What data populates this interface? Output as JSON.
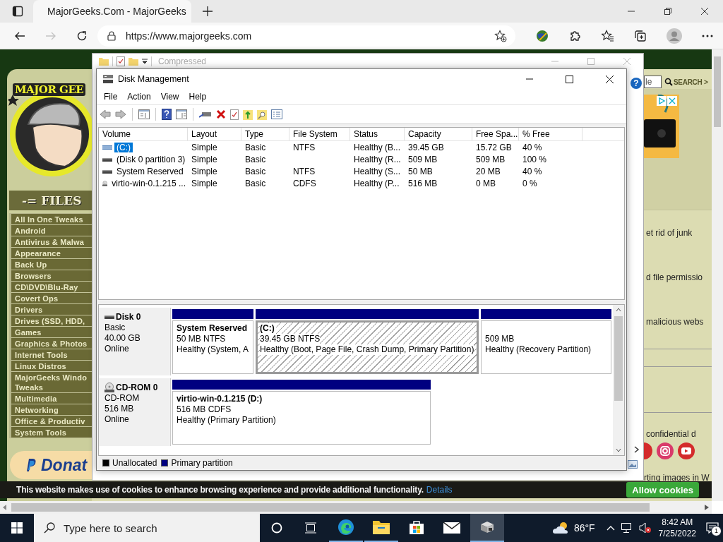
{
  "browser": {
    "tabs": [
      {
        "title": "MajorGeeks.Com - MajorGeeks",
        "selected": true
      }
    ],
    "url": "https://www.majorgeeks.com",
    "forward_disabled": true
  },
  "website": {
    "logo_text": "MAJOR GEE",
    "files_heading": "-= FILES",
    "categories": [
      {
        "label": "All In One Tweaks"
      },
      {
        "label": "Android"
      },
      {
        "label": "Antivirus & Malwa"
      },
      {
        "label": "Appearance"
      },
      {
        "label": "Back Up"
      },
      {
        "label": "Browsers"
      },
      {
        "label": "CD\\DVD\\Blu-Ray"
      },
      {
        "label": "Covert Ops"
      },
      {
        "label": "Drivers"
      },
      {
        "label": "Drives (SSD, HDD,"
      },
      {
        "label": "Games"
      },
      {
        "label": "Graphics & Photos"
      },
      {
        "label": "Internet Tools"
      },
      {
        "label": "Linux Distros"
      },
      {
        "label": "MajorGeeks Windo\nTweaks"
      },
      {
        "label": "Multimedia"
      },
      {
        "label": "Networking"
      },
      {
        "label": "Office & Productiv"
      },
      {
        "label": "System Tools"
      }
    ],
    "donate": "Donat",
    "search_value": "le",
    "search_label": "SEARCH >",
    "snippets": [
      "et rid of junk",
      "d file permissio",
      "malicious webs",
      "confidential d",
      "rting images in W"
    ],
    "cookie_bar": {
      "text": "This website makes use of cookies to enhance browsing experience and provide additional functionality.",
      "link": "Details",
      "button": "Allow cookies"
    }
  },
  "explorer": {
    "title": "Compressed",
    "help": "?"
  },
  "disk_management": {
    "title": "Disk Management",
    "menu": [
      "File",
      "Action",
      "View",
      "Help"
    ],
    "columns": [
      "Volume",
      "Layout",
      "Type",
      "File System",
      "Status",
      "Capacity",
      "Free Spa...",
      "% Free"
    ],
    "rows": [
      {
        "kind": "system",
        "volume": "(C:)",
        "layout": "Simple",
        "type": "Basic",
        "file_system": "NTFS",
        "status": "Healthy (B...",
        "capacity": "39.45 GB",
        "free_space": "15.72 GB",
        "percent_free": "40 %",
        "selected": true
      },
      {
        "kind": "drive",
        "volume": "(Disk 0 partition 3)",
        "layout": "Simple",
        "type": "Basic",
        "status": "Healthy (R...",
        "capacity": "509 MB",
        "free_space": "509 MB",
        "percent_free": "100 %",
        "selected": false
      },
      {
        "kind": "drive",
        "volume": "System Reserved",
        "layout": "Simple",
        "type": "Basic",
        "file_system": "NTFS",
        "status": "Healthy (S...",
        "capacity": "50 MB",
        "free_space": "20 MB",
        "percent_free": "40 %",
        "selected": false
      },
      {
        "kind": "cdrom",
        "volume": "virtio-win-0.1.215 ...",
        "layout": "Simple",
        "type": "Basic",
        "file_system": "CDFS",
        "status": "Healthy (P...",
        "capacity": "516 MB",
        "free_space": "0 MB",
        "percent_free": "0 %",
        "selected": false
      }
    ],
    "disks": [
      {
        "kind": "disk",
        "name": "Disk 0",
        "type": "Basic",
        "size": "40.00 GB",
        "status": "Online",
        "partitions": [
          {
            "name": "System Reserved",
            "detail": "50 MB NTFS",
            "status": "Healthy (System, A",
            "selected": false
          },
          {
            "name": "(C:)",
            "detail": "39.45 GB NTFS",
            "status": "Healthy (Boot, Page File, Crash Dump, Primary Partition)",
            "selected": true
          },
          {
            "detail": "509 MB",
            "status": "Healthy (Recovery Partition)",
            "selected": false
          }
        ]
      },
      {
        "kind": "cdrom",
        "name": "CD-ROM 0",
        "type": "CD-ROM",
        "size": "516 MB",
        "status": "Online",
        "partitions": [
          {
            "name": "virtio-win-0.1.215  (D:)",
            "detail": "516 MB CDFS",
            "status": "Healthy (Primary Partition)",
            "selected": false
          }
        ]
      }
    ],
    "legend": [
      {
        "label": "Unallocated",
        "color": "#000000"
      },
      {
        "label": "Primary partition",
        "color": "#000080"
      }
    ]
  },
  "taskbar": {
    "search_placeholder": "Type here to search",
    "apps": [
      {
        "kind": "edge",
        "running": true,
        "active": false
      },
      {
        "kind": "explorer",
        "running": true,
        "active": false
      },
      {
        "kind": "store",
        "running": false,
        "active": false
      },
      {
        "kind": "mail",
        "running": false,
        "active": false
      },
      {
        "kind": "diskmgmt",
        "running": true,
        "active": true
      }
    ],
    "weather": "86°F",
    "time": "8:42 AM",
    "date": "7/25/2022",
    "notifications": "1"
  }
}
